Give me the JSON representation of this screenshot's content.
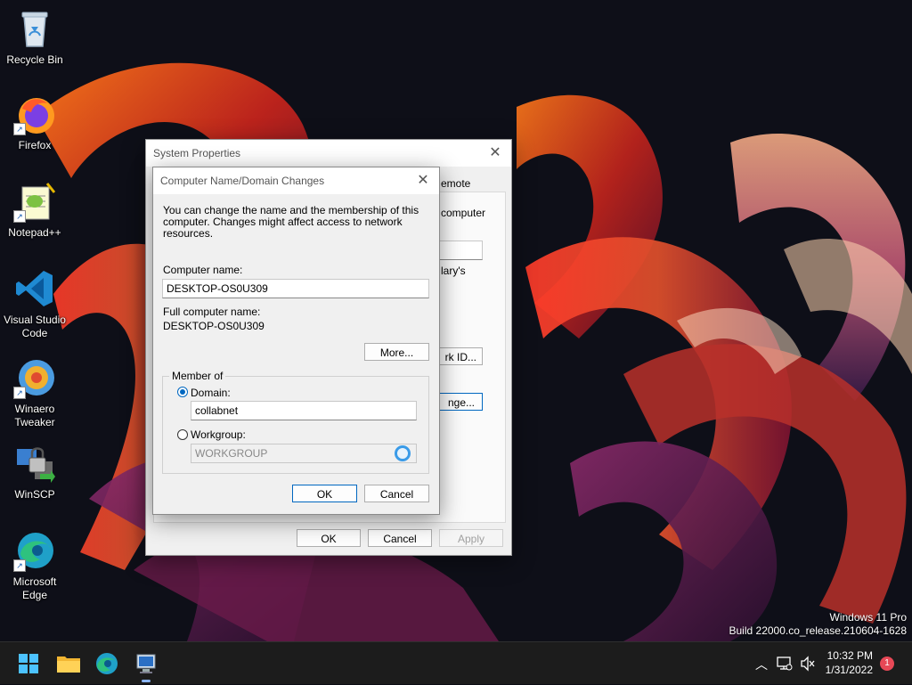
{
  "desktop": {
    "icons": [
      {
        "label": "Recycle Bin",
        "icon": "recycle-bin-icon"
      },
      {
        "label": "Firefox",
        "icon": "firefox-icon"
      },
      {
        "label": "Notepad++",
        "icon": "notepad-plus-plus-icon"
      },
      {
        "label": "Visual Studio Code",
        "icon": "vscode-icon"
      },
      {
        "label": "Winaero Tweaker",
        "icon": "winaero-tweaker-icon"
      },
      {
        "label": "WinSCP",
        "icon": "winscp-icon"
      },
      {
        "label": "Microsoft Edge",
        "icon": "edge-icon"
      }
    ],
    "watermark": {
      "line1": "Windows 11 Pro",
      "line2": "Build 22000.co_release.210604-1628"
    }
  },
  "system_properties": {
    "title": "System Properties",
    "partial_tab": "emote",
    "partial_text1": "computer",
    "partial_text2": "lary's",
    "partial_button1": "rk ID...",
    "partial_button2": "nge...",
    "ok_label": "OK",
    "cancel_label": "Cancel",
    "apply_label": "Apply"
  },
  "domain_dialog": {
    "title": "Computer Name/Domain Changes",
    "description": "You can change the name and the membership of this computer. Changes might affect access to network resources.",
    "computer_name_label": "Computer name:",
    "computer_name_value": "DESKTOP-OS0U309",
    "full_name_label": "Full computer name:",
    "full_name_value": "DESKTOP-OS0U309",
    "more_label": "More...",
    "member_of_label": "Member of",
    "domain_label": "Domain:",
    "domain_value": "collabnet",
    "workgroup_label": "Workgroup:",
    "workgroup_value": "WORKGROUP",
    "selected": "domain",
    "ok_label": "OK",
    "cancel_label": "Cancel"
  },
  "taskbar": {
    "time": "10:32 PM",
    "date": "1/31/2022",
    "notification_count": "1"
  },
  "colors": {
    "accent": "#0067c0",
    "taskbar": "#1c1c1c",
    "badge": "#e74856"
  }
}
